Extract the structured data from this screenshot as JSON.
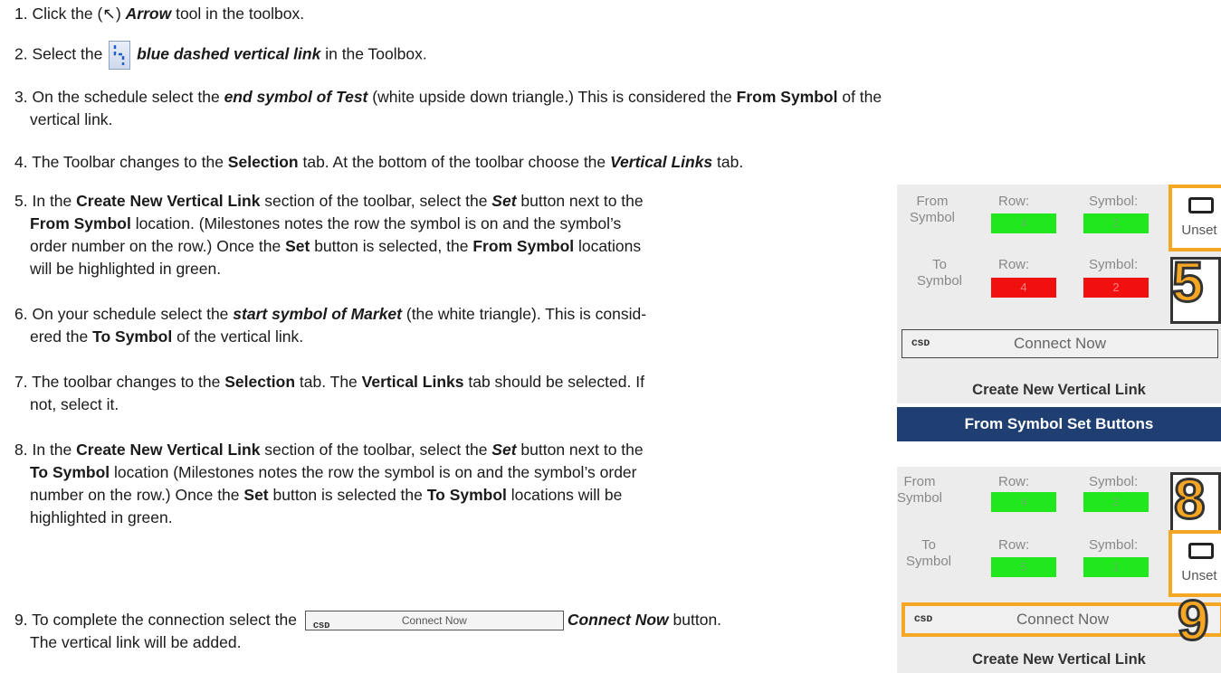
{
  "steps": [
    {
      "num": "1.",
      "a": "Click  the (",
      "arrow": "↖",
      "b": ") ",
      "c_b": "Arrow",
      "d": " tool in the toolbox."
    },
    {
      "num": "2.",
      "a": "Select the ",
      "c_b": "blue dashed vertical link",
      "d": " in the Toolbox."
    },
    {
      "num": "3.",
      "a": "On the schedule select the ",
      "c_b": "end symbol of Test",
      "d": " (white upside down triangle.)  This is considered the ",
      "e_b": "From Symbol",
      "f": " of the",
      "line2": "vertical link."
    },
    {
      "num": "4.",
      "a": "The Toolbar changes to the ",
      "b_b": "Selection",
      "c": " tab.  At the bottom of the toolbar choose the ",
      "d_b": "Vertical Links",
      "e": " tab."
    },
    {
      "num": "5.",
      "l1a": "In the ",
      "l1b": "Create New Vertical Link",
      "l1c": " section of the toolbar, select the ",
      "l1d": "Set",
      "l1e": " button next to the",
      "l2a": "From Symbol",
      "l2b": " location.  (Milestones notes the row the symbol is on and the symbol’s",
      "l3a": "order number on the row.)  Once the ",
      "l3b": "Set",
      "l3c": " button is selected, the ",
      "l3d": "From Symbol",
      "l3e": " locations",
      "l4": "will be highlighted in green."
    },
    {
      "num": "6.",
      "l1a": "On your schedule select the ",
      "l1b": "start symbol of Market",
      "l1c": "  (the white triangle).  This is consid-",
      "l2a": "ered the ",
      "l2b": "To Symbol",
      "l2c": " of the vertical link."
    },
    {
      "num": "7.",
      "l1a": "The toolbar changes to the ",
      "l1b": "Selection",
      "l1c": " tab.  The ",
      "l1d": "Vertical Links",
      "l1e": " tab should be selected.  If",
      "l2": "not, select it."
    },
    {
      "num": "8.",
      "l1a": "In the ",
      "l1b": "Create New Vertical Link",
      "l1c": " section of the toolbar, select the ",
      "l1d": "Set",
      "l1e": " button next to the",
      "l2a": "To Symbol",
      "l2b": " location (Milestones notes the row the symbol is on and the symbol’s order",
      "l3a": "number on the row.)  Once the ",
      "l3b": "Set",
      "l3c": " button is selected the ",
      "l3d": "To Symbol",
      "l3e": " locations will be",
      "l4": "highlighted in green."
    },
    {
      "num": "9.",
      "l1a": "To complete the connection select the ",
      "l1b": "Connect Now",
      "l1c": " button.",
      "l2": "The vertical link will be added."
    }
  ],
  "inline_button": {
    "chain": "ᴄѕᴅ",
    "label": "Connect Now"
  },
  "panel1": {
    "from_label": "From\nSymbol",
    "to_label": "To\nSymbol",
    "row": "Row:",
    "symbol": "Symbol:",
    "from_row": "4",
    "from_sym": "2",
    "to_row": "4",
    "to_sym": "2",
    "unset": "Unset",
    "badge": "5",
    "connect": "Connect Now",
    "caption": "Create New Vertical Link"
  },
  "bar_caption": "From Symbol Set Buttons",
  "panel2": {
    "from_label": "From\nSymbol",
    "to_label": "To\nSymbol",
    "row": "Row:",
    "symbol": "Symbol:",
    "from_row": "4",
    "from_sym": "2",
    "to_row": "5",
    "to_sym": "1",
    "unset": "Unset",
    "badge_top": "8",
    "badge_bottom": "9",
    "connect": "Connect Now",
    "caption": "Create New Vertical Link"
  },
  "colors": {
    "green": "#21e81c",
    "red": "#f01010",
    "orange": "#f5a623",
    "navy": "#1f3f73"
  }
}
